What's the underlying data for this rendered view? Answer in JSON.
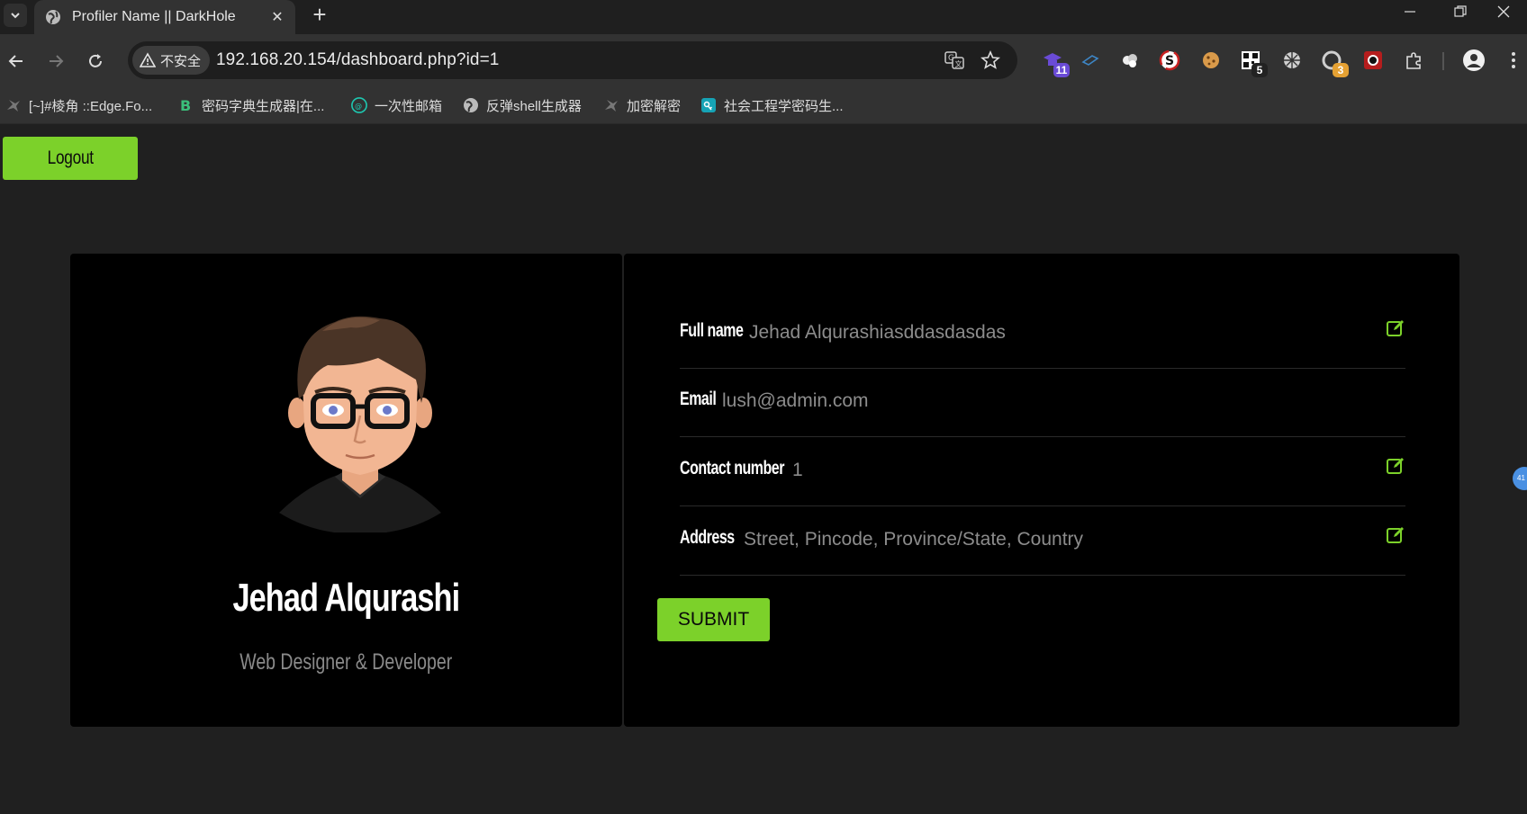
{
  "browser": {
    "tab_title": "Profiler Name || DarkHole",
    "security_label": "不安全",
    "url": "192.168.20.154/dashboard.php?id=1",
    "extension_badges": {
      "ext1": "11",
      "ext6": "5",
      "ext8": "3"
    },
    "bookmarks": [
      {
        "label": "[~]#棱角 ::Edge.Fo..."
      },
      {
        "label": "密码字典生成器|在..."
      },
      {
        "label": "一次性邮箱"
      },
      {
        "label": "反弹shell生成器"
      },
      {
        "label": "加密解密"
      },
      {
        "label": "社会工程学密码生..."
      }
    ],
    "floating_badge": "41"
  },
  "page": {
    "logout_label": "Logout",
    "profile": {
      "name": "Jehad Alqurashi",
      "role": "Web Designer & Developer"
    },
    "fields": [
      {
        "label": "Full name",
        "value": "Jehad Alqurashiasddasdasdas",
        "editable": true
      },
      {
        "label": "Email",
        "value": "lush@admin.com",
        "editable": false
      },
      {
        "label": "Contact number",
        "value": "1",
        "editable": true
      },
      {
        "label": "Address",
        "value": "Street, Pincode, Province/State, Country",
        "editable": true
      }
    ],
    "submit_label": "SUBMIT"
  },
  "colors": {
    "accent": "#7cd12a",
    "card_bg": "#000000",
    "page_bg": "#202020",
    "muted_text": "#8c8c8c"
  }
}
